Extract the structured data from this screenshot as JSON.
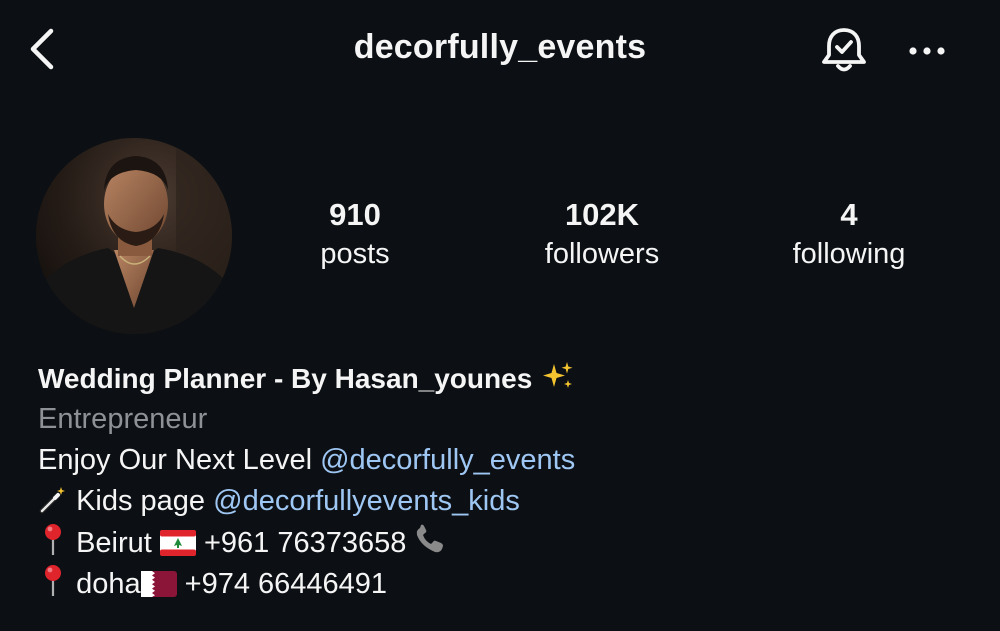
{
  "header": {
    "username": "decorfully_events"
  },
  "stats": {
    "posts": {
      "count": "910",
      "label": "posts"
    },
    "followers": {
      "count": "102K",
      "label": "followers"
    },
    "following": {
      "count": "4",
      "label": "following"
    }
  },
  "bio": {
    "name": "Wedding Planner - By Hasan_younes",
    "category": "Entrepreneur",
    "line1_text": "Enjoy Our Next Level",
    "line1_mention": "@decorfully_events",
    "line2_text": "Kids page",
    "line2_mention": "@decorfullyevents_kids",
    "line3_city": "Beirut",
    "line3_phone": "+961 76373658",
    "line4_city": "doha",
    "line4_phone": "+974 66446491"
  },
  "icons": {
    "back": "chevron-left-icon",
    "notifications": "bell-check-icon",
    "more": "ellipsis-icon",
    "sparkles": "sparkles-icon",
    "magic_wand": "magic-wand-icon",
    "pin": "round-pushpin-icon",
    "flag_lebanon": "flag-lebanon-icon",
    "flag_qatar": "flag-qatar-icon",
    "phone": "telephone-receiver-icon"
  },
  "colors": {
    "background": "#0c1014",
    "text": "#f5f5f5",
    "secondary_text": "#8e9196",
    "mention": "#9fc7f4"
  }
}
